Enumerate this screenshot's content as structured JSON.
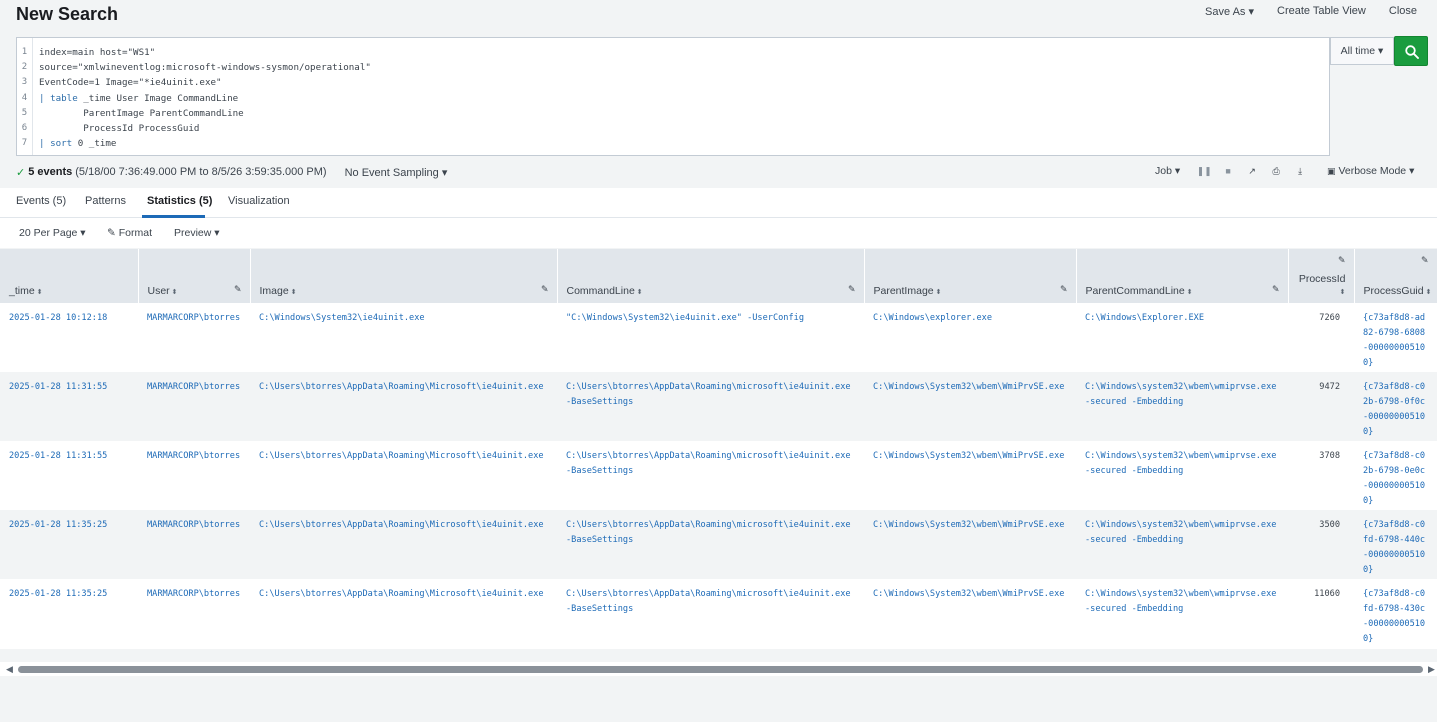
{
  "title": "New Search",
  "top_actions": [
    "Save As",
    "Create Table View",
    "Close"
  ],
  "query_lines": [
    "index=main host=\"WS1\"",
    "source=\"xmlwineventlog:microsoft-windows-sysmon/operational\"",
    "EventCode=1 Image=\"*ie4uinit.exe\"",
    "| table _time User Image CommandLine",
    "        ParentImage ParentCommandLine",
    "        ProcessId ProcessGuid",
    "| sort 0 _time"
  ],
  "line_numbers": [
    "1",
    "2",
    "3",
    "4",
    "5",
    "6",
    "7"
  ],
  "time_picker": "All time",
  "status": {
    "events": "5 events",
    "range": "(5/18/00 7:36:49.000 PM to 8/5/26 3:59:35.000 PM)",
    "sampling": "No Event Sampling",
    "job": "Job",
    "mode": "Verbose Mode"
  },
  "tabs": [
    "Events (5)",
    "Patterns",
    "Statistics (5)",
    "Visualization"
  ],
  "options": {
    "per_page": "20 Per Page",
    "format": "Format",
    "preview": "Preview"
  },
  "columns": [
    "_time",
    "User",
    "Image",
    "CommandLine",
    "ParentImage",
    "ParentCommandLine",
    "ProcessId",
    "ProcessGuid"
  ],
  "rows": [
    {
      "time": "2025-01-28 10:12:18",
      "user": "MARMARCORP\\btorres",
      "image": "C:\\Windows\\System32\\ie4uinit.exe",
      "cmd": "\"C:\\Windows\\System32\\ie4uinit.exe\" -UserConfig",
      "pimage": "C:\\Windows\\explorer.exe",
      "pcmd": "C:\\Windows\\Explorer.EXE",
      "pid": "7260",
      "guid": "{c73af8d8-ad82-6798-6808-000000005100}"
    },
    {
      "time": "2025-01-28 11:31:55",
      "user": "MARMARCORP\\btorres",
      "image": "C:\\Users\\btorres\\AppData\\Roaming\\Microsoft\\ie4uinit.exe",
      "cmd": "C:\\Users\\btorres\\AppData\\Roaming\\microsoft\\ie4uinit.exe -BaseSettings",
      "pimage": "C:\\Windows\\System32\\wbem\\WmiPrvSE.exe",
      "pcmd": "C:\\Windows\\system32\\wbem\\wmiprvse.exe -secured -Embedding",
      "pid": "9472",
      "guid": "{c73af8d8-c02b-6798-0f0c-000000005100}"
    },
    {
      "time": "2025-01-28 11:31:55",
      "user": "MARMARCORP\\btorres",
      "image": "C:\\Users\\btorres\\AppData\\Roaming\\Microsoft\\ie4uinit.exe",
      "cmd": "C:\\Users\\btorres\\AppData\\Roaming\\microsoft\\ie4uinit.exe -BaseSettings",
      "pimage": "C:\\Windows\\System32\\wbem\\WmiPrvSE.exe",
      "pcmd": "C:\\Windows\\system32\\wbem\\wmiprvse.exe -secured -Embedding",
      "pid": "3708",
      "guid": "{c73af8d8-c02b-6798-0e0c-000000005100}"
    },
    {
      "time": "2025-01-28 11:35:25",
      "user": "MARMARCORP\\btorres",
      "image": "C:\\Users\\btorres\\AppData\\Roaming\\Microsoft\\ie4uinit.exe",
      "cmd": "C:\\Users\\btorres\\AppData\\Roaming\\microsoft\\ie4uinit.exe -BaseSettings",
      "pimage": "C:\\Windows\\System32\\wbem\\WmiPrvSE.exe",
      "pcmd": "C:\\Windows\\system32\\wbem\\wmiprvse.exe -secured -Embedding",
      "pid": "3500",
      "guid": "{c73af8d8-c0fd-6798-440c-000000005100}"
    },
    {
      "time": "2025-01-28 11:35:25",
      "user": "MARMARCORP\\btorres",
      "image": "C:\\Users\\btorres\\AppData\\Roaming\\Microsoft\\ie4uinit.exe",
      "cmd": "C:\\Users\\btorres\\AppData\\Roaming\\microsoft\\ie4uinit.exe -BaseSettings",
      "pimage": "C:\\Windows\\System32\\wbem\\WmiPrvSE.exe",
      "pcmd": "C:\\Windows\\system32\\wbem\\wmiprvse.exe -secured -Embedding",
      "pid": "11060",
      "guid": "{c73af8d8-c0fd-6798-430c-000000005100}"
    }
  ],
  "colors": {
    "accent": "#1d6ab7",
    "search_button": "#1a9c3e",
    "header_bg": "#e1e6eb"
  }
}
